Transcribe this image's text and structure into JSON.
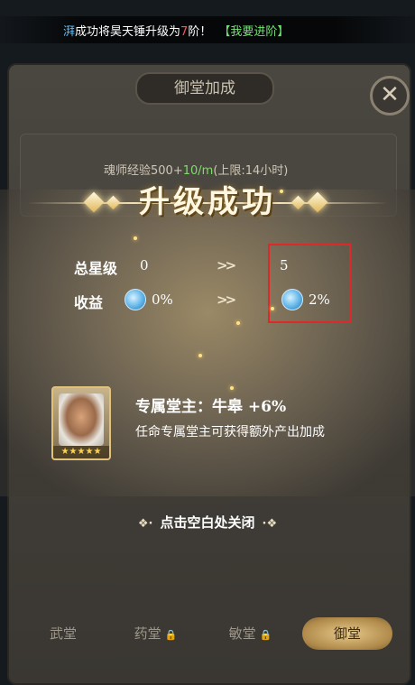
{
  "ticker": {
    "player_name": "湃",
    "text_before": "成功将昊天锤升级为",
    "level_num": "7",
    "text_after": "阶！",
    "link": "【我要进阶】"
  },
  "background": {
    "panel_title": "御堂加成",
    "close_icon": "close-x",
    "exp_label": "魂师经验500+",
    "exp_bonus": "10/m",
    "exp_cap": "(上限:14小时)"
  },
  "tabs": [
    {
      "label": "武堂",
      "locked": false,
      "active": false
    },
    {
      "label": "药堂",
      "locked": true,
      "active": false
    },
    {
      "label": "敏堂",
      "locked": true,
      "active": false
    },
    {
      "label": "御堂",
      "locked": false,
      "active": true
    }
  ],
  "popup": {
    "title": "升级成功",
    "stats": [
      {
        "label": "总星级",
        "from": "0",
        "to": "5",
        "icon": null
      },
      {
        "label": "收益",
        "from": "0%",
        "to": "2%",
        "icon": "potion-icon"
      }
    ],
    "arrow": ">>",
    "hero": {
      "stars": "★★★★★",
      "title": "专属堂主：牛皋",
      "bonus": "+6%",
      "description": "任命专属堂主可获得额外产出加成"
    },
    "close_hint": "点击空白处关闭",
    "accent_red": "#e02828",
    "title_color": "#fff7e0"
  }
}
